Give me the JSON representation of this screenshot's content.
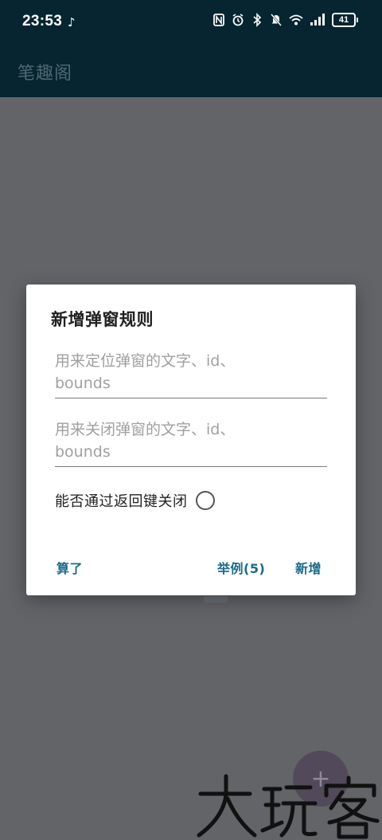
{
  "status_bar": {
    "time": "23:53",
    "battery_level": "41",
    "icons": [
      "tiktok-icon",
      "nfc-icon",
      "alarm-icon",
      "bluetooth-icon",
      "mute-icon",
      "wifi-icon",
      "signal-icon",
      "battery-icon"
    ]
  },
  "app_bar": {
    "title": "笔趣阁"
  },
  "dialog": {
    "title": "新增弹窗规则",
    "locate_placeholder": "用来定位弹窗的文字、id、\nbounds",
    "close_placeholder": "用来关闭弹窗的文字、id、\nbounds",
    "back_key_label": "能否通过返回键关闭",
    "back_key_checked": false,
    "cancel_label": "算了",
    "example_label": "举例(5)",
    "add_label": "新增"
  },
  "fab": {
    "icon": "plus-icon",
    "symbol": "+"
  },
  "watermark": {
    "text": "大玩客"
  },
  "colors": {
    "scrim": "#636468",
    "app_bar": "#062530",
    "accent": "#1a6b8a",
    "dialog_bg": "#ffffff"
  }
}
